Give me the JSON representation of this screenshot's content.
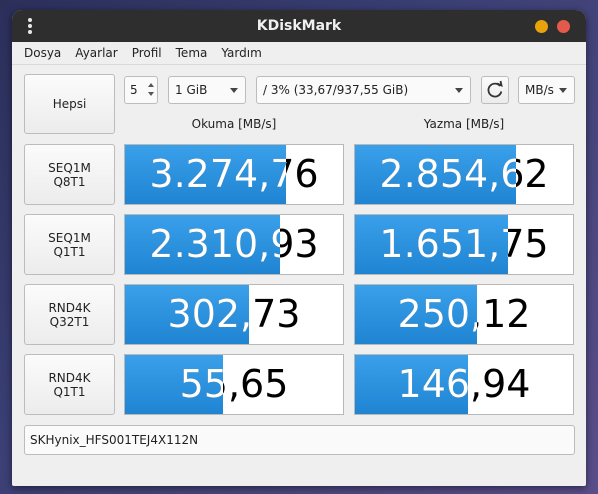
{
  "window": {
    "title": "KDiskMark"
  },
  "menu": [
    "Dosya",
    "Ayarlar",
    "Profil",
    "Tema",
    "Yardım"
  ],
  "controls": {
    "all_button": "Hepsi",
    "runs": "5",
    "file_size": "1 GiB",
    "target": "/ 3% (33,67/937,55 GiB)",
    "units": "MB/s"
  },
  "headers": {
    "read": "Okuma [MB/s]",
    "write": "Yazma [MB/s]"
  },
  "tests": [
    {
      "line1": "SEQ1M",
      "line2": "Q8T1",
      "read": "3.274,76",
      "read_fill": 0.74,
      "write": "2.854,62",
      "write_fill": 0.74
    },
    {
      "line1": "SEQ1M",
      "line2": "Q1T1",
      "read": "2.310,93",
      "read_fill": 0.71,
      "write": "1.651,75",
      "write_fill": 0.7
    },
    {
      "line1": "RND4K",
      "line2": "Q32T1",
      "read": "302,73",
      "read_fill": 0.57,
      "write": "250,12",
      "write_fill": 0.56
    },
    {
      "line1": "RND4K",
      "line2": "Q1T1",
      "read": "55,65",
      "read_fill": 0.45,
      "write": "146,94",
      "write_fill": 0.52
    }
  ],
  "device": "SKHynix_HFS001TEJ4X112N"
}
